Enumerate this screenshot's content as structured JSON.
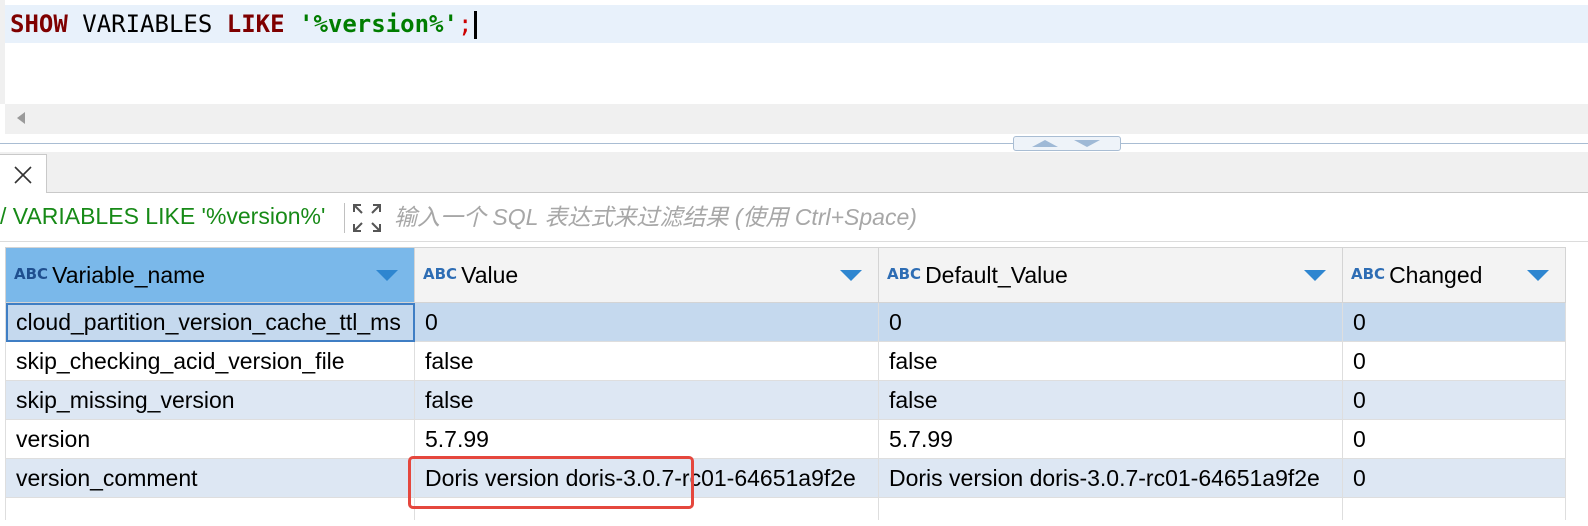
{
  "editor": {
    "keyword_show": "SHOW",
    "text_variables": " VARIABLES ",
    "keyword_like": "LIKE",
    "space": " ",
    "string_literal": "'%version%'",
    "semicolon": ";"
  },
  "results": {
    "tab_close_icon": "close-icon",
    "query_label": "/ VARIABLES LIKE '%version%'",
    "filter_placeholder": "输入一个 SQL 表达式来过滤结果 (使用 Ctrl+Space)",
    "type_badge": "ABC",
    "columns": [
      "Variable_name",
      "Value",
      "Default_Value",
      "Changed"
    ],
    "rows": [
      [
        "cloud_partition_version_cache_ttl_ms",
        "0",
        "0",
        "0"
      ],
      [
        "skip_checking_acid_version_file",
        "false",
        "false",
        "0"
      ],
      [
        "skip_missing_version",
        "false",
        "false",
        "0"
      ],
      [
        "version",
        "5.7.99",
        "5.7.99",
        "0"
      ],
      [
        "version_comment",
        "Doris version doris-3.0.7-rc01-64651a9f2e",
        "Doris version doris-3.0.7-rc01-64651a9f2e",
        "0"
      ]
    ]
  },
  "colors": {
    "selected_header": "#7ab8ea",
    "selected_row": "#c5d9ee",
    "alt_row": "#dde7f3",
    "annotation": "#e5473d",
    "query_label": "#178a17"
  }
}
